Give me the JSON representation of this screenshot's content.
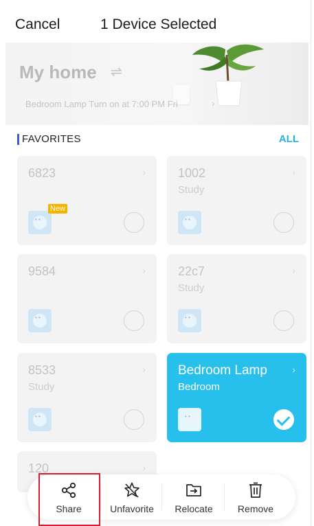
{
  "topbar": {
    "cancel_label": "Cancel",
    "title": "1 Device Selected"
  },
  "hero": {
    "home_name": "My home",
    "swap_icon": "⇌",
    "schedule_text": "Bedroom Lamp Turn on at 7:00 PM Fri",
    "chevron": "›"
  },
  "favorites": {
    "label": "FAVORITES",
    "all_label": "ALL"
  },
  "devices": [
    {
      "name": "6823",
      "room": "",
      "badge": "New",
      "selected": false
    },
    {
      "name": "1002",
      "room": "Study",
      "badge": "",
      "selected": false
    },
    {
      "name": "9584",
      "room": "",
      "badge": "",
      "selected": false
    },
    {
      "name": "22c7",
      "room": "Study",
      "badge": "",
      "selected": false
    },
    {
      "name": "8533",
      "room": "Study",
      "badge": "",
      "selected": false
    },
    {
      "name": "Bedroom Lamp",
      "room": "Bedroom",
      "badge": "",
      "selected": true
    },
    {
      "name": "120",
      "room": "",
      "badge": "",
      "selected": false
    }
  ],
  "toolbar": {
    "share_label": "Share",
    "unfavorite_label": "Unfavorite",
    "relocate_label": "Relocate",
    "remove_label": "Remove"
  },
  "icons": {
    "share": "share-icon",
    "unfavorite": "star-slash-icon",
    "relocate": "folder-move-icon",
    "remove": "trash-icon"
  },
  "colors": {
    "accent": "#27c0ec",
    "link": "#27b3e6",
    "highlight": "#d51d2f",
    "favorites_bar": "#3a5bd9"
  }
}
